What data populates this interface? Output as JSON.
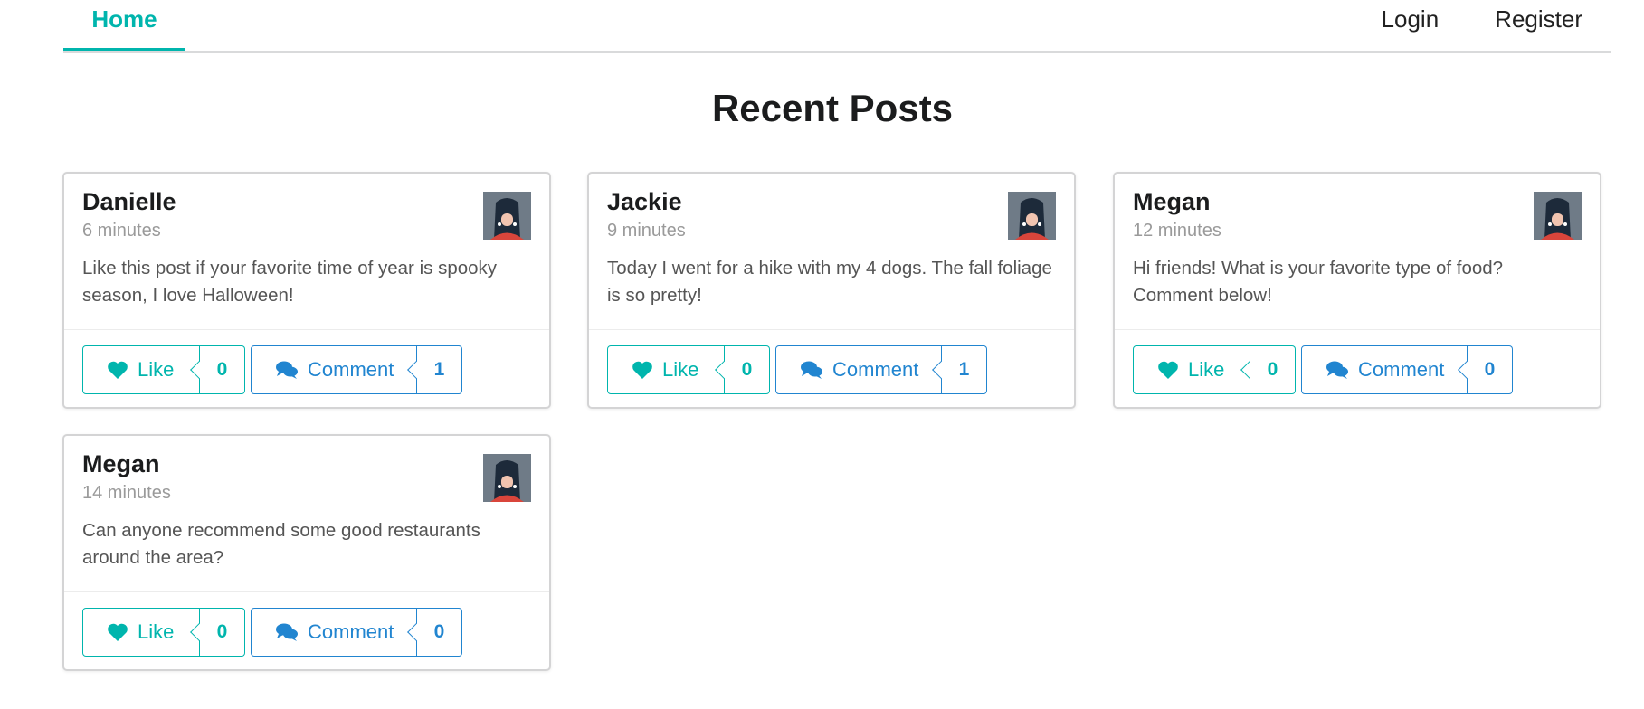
{
  "nav": {
    "home_label": "Home",
    "login_label": "Login",
    "register_label": "Register"
  },
  "page_title": "Recent Posts",
  "icons": {
    "like": "heart-icon",
    "comment": "comments-icon",
    "avatar": "avatar-image"
  },
  "colors": {
    "accent_teal": "#00b5ad",
    "accent_blue": "#2185d0"
  },
  "posts": [
    {
      "author": "Danielle",
      "time": "6 minutes",
      "body": "Like this post if your favorite time of year is spooky season, I love Halloween!",
      "like_label": "Like",
      "likes": "0",
      "comment_label": "Comment",
      "comments": "1"
    },
    {
      "author": "Jackie",
      "time": "9 minutes",
      "body": "Today I went for a hike with my 4 dogs. The fall foliage is so pretty!",
      "like_label": "Like",
      "likes": "0",
      "comment_label": "Comment",
      "comments": "1"
    },
    {
      "author": "Megan",
      "time": "12 minutes",
      "body": "Hi friends! What is your favorite type of food? Comment below!",
      "like_label": "Like",
      "likes": "0",
      "comment_label": "Comment",
      "comments": "0"
    },
    {
      "author": "Megan",
      "time": "14 minutes",
      "body": "Can anyone recommend some good restaurants around the area?",
      "like_label": "Like",
      "likes": "0",
      "comment_label": "Comment",
      "comments": "0"
    }
  ]
}
